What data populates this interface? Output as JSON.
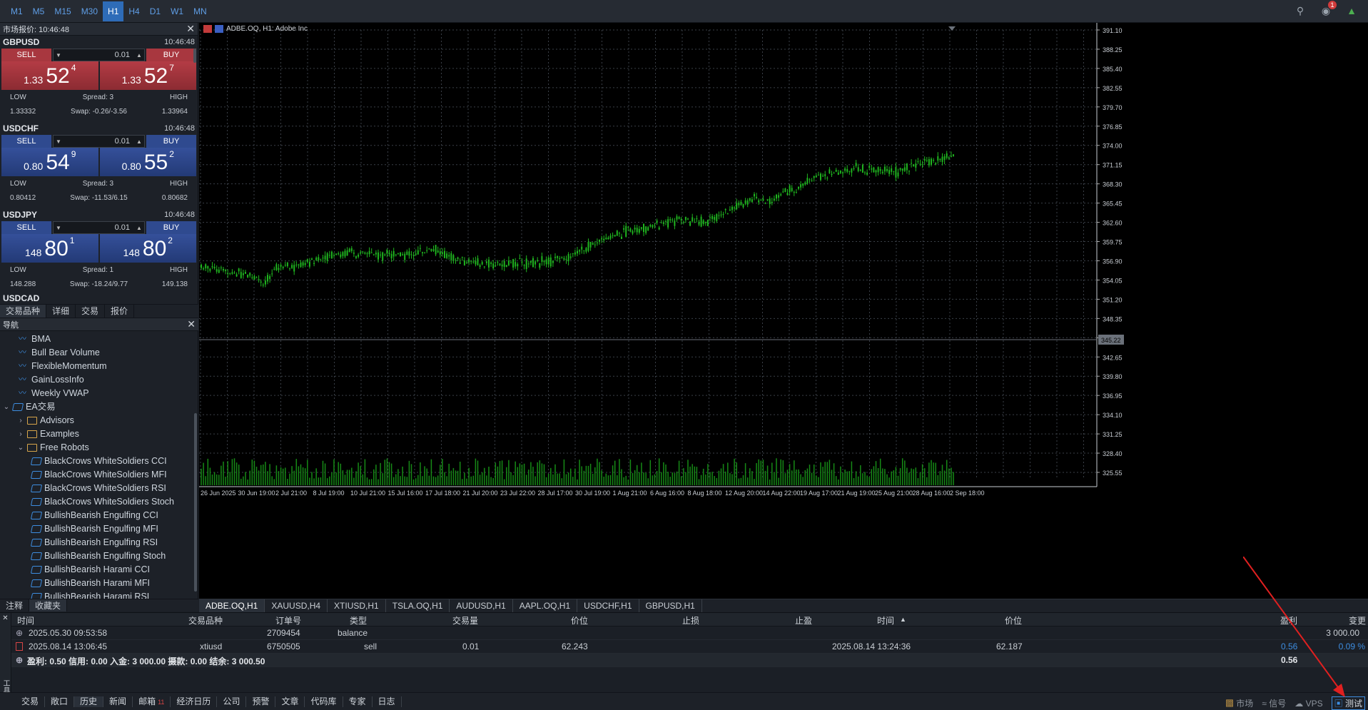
{
  "timeframes": [
    "M1",
    "M5",
    "M15",
    "M30",
    "H1",
    "H4",
    "D1",
    "W1",
    "MN"
  ],
  "active_timeframe": "H1",
  "notif_count": "1",
  "market_watch": {
    "title": "市场报价: 10:46:48",
    "quotes": [
      {
        "symbol": "GBPUSD",
        "time": "10:46:48",
        "sell": "SELL",
        "buy": "BUY",
        "vol": "0.01",
        "bid_small": "1.33",
        "bid_big": "52",
        "bid_sup": "4",
        "ask_small": "1.33",
        "ask_big": "52",
        "ask_sup": "7",
        "low_label": "LOW",
        "spread": "Spread: 3",
        "high_label": "HIGH",
        "low": "1.33332",
        "swap": "Swap: -0.26/-3.56",
        "high": "1.33964",
        "color": "red"
      },
      {
        "symbol": "USDCHF",
        "time": "10:46:48",
        "sell": "SELL",
        "buy": "BUY",
        "vol": "0.01",
        "bid_small": "0.80",
        "bid_big": "54",
        "bid_sup": "9",
        "ask_small": "0.80",
        "ask_big": "55",
        "ask_sup": "2",
        "low_label": "LOW",
        "spread": "Spread: 3",
        "high_label": "HIGH",
        "low": "0.80412",
        "swap": "Swap: -11.53/6.15",
        "high": "0.80682",
        "color": "blue"
      },
      {
        "symbol": "USDJPY",
        "time": "10:46:48",
        "sell": "SELL",
        "buy": "BUY",
        "vol": "0.01",
        "bid_small": "148",
        "bid_big": "80",
        "bid_sup": "1",
        "ask_small": "148",
        "ask_big": "80",
        "ask_sup": "2",
        "low_label": "LOW",
        "spread": "Spread: 1",
        "high_label": "HIGH",
        "low": "148.288",
        "swap": "Swap: -18.24/9.77",
        "high": "149.138",
        "color": "blue"
      }
    ],
    "partial_symbol": "USDCAD",
    "tabs": [
      "交易品种",
      "详细",
      "交易",
      "报价"
    ]
  },
  "navigator": {
    "title": "导航",
    "items": [
      {
        "label": "BMA",
        "level": 2,
        "icon": "indicator"
      },
      {
        "label": "Bull Bear Volume",
        "level": 2,
        "icon": "indicator"
      },
      {
        "label": "FlexibleMomentum",
        "level": 2,
        "icon": "indicator"
      },
      {
        "label": "GainLossInfo",
        "level": 2,
        "icon": "indicator"
      },
      {
        "label": "Weekly VWAP",
        "level": 2,
        "icon": "indicator"
      },
      {
        "label": "EA交易",
        "level": 0,
        "icon": "ea",
        "arrow": "v"
      },
      {
        "label": "Advisors",
        "level": 1,
        "icon": "folder",
        "arrow": ">"
      },
      {
        "label": "Examples",
        "level": 1,
        "icon": "folder",
        "arrow": ">"
      },
      {
        "label": "Free Robots",
        "level": 1,
        "icon": "folder",
        "arrow": "v"
      },
      {
        "label": "BlackCrows WhiteSoldiers CCI",
        "level": 3,
        "icon": "ea"
      },
      {
        "label": "BlackCrows WhiteSoldiers MFI",
        "level": 3,
        "icon": "ea"
      },
      {
        "label": "BlackCrows WhiteSoldiers RSI",
        "level": 3,
        "icon": "ea"
      },
      {
        "label": "BlackCrows WhiteSoldiers Stoch",
        "level": 3,
        "icon": "ea"
      },
      {
        "label": "BullishBearish Engulfing CCI",
        "level": 3,
        "icon": "ea"
      },
      {
        "label": "BullishBearish Engulfing MFI",
        "level": 3,
        "icon": "ea"
      },
      {
        "label": "BullishBearish Engulfing RSI",
        "level": 3,
        "icon": "ea"
      },
      {
        "label": "BullishBearish Engulfing Stoch",
        "level": 3,
        "icon": "ea"
      },
      {
        "label": "BullishBearish Harami CCI",
        "level": 3,
        "icon": "ea"
      },
      {
        "label": "BullishBearish Harami MFI",
        "level": 3,
        "icon": "ea"
      },
      {
        "label": "BullishBearish Harami RSI",
        "level": 3,
        "icon": "ea"
      }
    ],
    "tabs": [
      "注释",
      "收藏夹"
    ]
  },
  "chart": {
    "header": "ADBE.OQ, H1:  Adobe Inc",
    "price_ticks": [
      "391.10",
      "388.25",
      "385.40",
      "382.55",
      "379.70",
      "376.85",
      "374.00",
      "371.15",
      "368.30",
      "365.45",
      "362.60",
      "359.75",
      "356.90",
      "354.05",
      "351.20",
      "348.35",
      "345.50",
      "342.65",
      "339.80",
      "336.95",
      "334.10",
      "331.25",
      "328.40",
      "325.55"
    ],
    "current_price": "345.22",
    "time_ticks": [
      "26 Jun 2025",
      "30 Jun 19:00",
      "2 Jul 21:00",
      "8 Jul 19:00",
      "10 Jul 21:00",
      "15 Jul 16:00",
      "17 Jul 18:00",
      "21 Jul 20:00",
      "23 Jul 22:00",
      "28 Jul 17:00",
      "30 Jul 19:00",
      "1 Aug 21:00",
      "6 Aug 16:00",
      "8 Aug 18:00",
      "12 Aug 20:00",
      "14 Aug 22:00",
      "19 Aug 17:00",
      "21 Aug 19:00",
      "25 Aug 21:00",
      "28 Aug 16:00",
      "2 Sep 18:00"
    ]
  },
  "chart_tabs": [
    "ADBE.OQ,H1",
    "XAUUSD,H4",
    "XTIUSD,H1",
    "TSLA.OQ,H1",
    "AUDUSD,H1",
    "AAPL.OQ,H1",
    "USDCHF,H1",
    "GBPUSD,H1"
  ],
  "active_chart_tab": "ADBE.OQ,H1",
  "trade": {
    "headers": {
      "time": "时间",
      "symbol": "交易品种",
      "order": "订单号",
      "type": "类型",
      "volume": "交易量",
      "price": "价位",
      "sl": "止损",
      "tp": "止盈",
      "time2": "时间",
      "price2": "价位",
      "profit": "盈利",
      "change": "变更"
    },
    "rows": [
      {
        "time": "2025.05.30 09:53:58",
        "symbol": "",
        "order": "2709454",
        "type": "balance",
        "volume": "",
        "price": "",
        "sl": "",
        "tp": "",
        "time2": "",
        "price2": "",
        "profit": "3 000.00",
        "change": ""
      },
      {
        "time": "2025.08.14 13:06:45",
        "symbol": "xtiusd",
        "order": "6750505",
        "type": "sell",
        "volume": "0.01",
        "price": "62.243",
        "sl": "",
        "tp": "",
        "time2": "2025.08.14 13:24:36",
        "price2": "62.187",
        "profit": "0.56",
        "change": "0.09 %"
      }
    ],
    "summary": "盈利: 0.50  信用: 0.00  入金: 3 000.00  摄款: 0.00  结余: 3 000.50",
    "summary_profit": "0.56"
  },
  "side_label": "工具箱",
  "bottom_tabs": [
    {
      "label": "交易"
    },
    {
      "label": "敞口"
    },
    {
      "label": "历史"
    },
    {
      "label": "新闻"
    },
    {
      "label": "邮箱",
      "count": "11"
    },
    {
      "label": "经济日历"
    },
    {
      "label": "公司"
    },
    {
      "label": "预警"
    },
    {
      "label": "文章"
    },
    {
      "label": "代码库"
    },
    {
      "label": "专家"
    },
    {
      "label": "日志"
    }
  ],
  "status": {
    "market": "市场",
    "signal": "信号",
    "vps": "VPS",
    "tester": "测试"
  }
}
